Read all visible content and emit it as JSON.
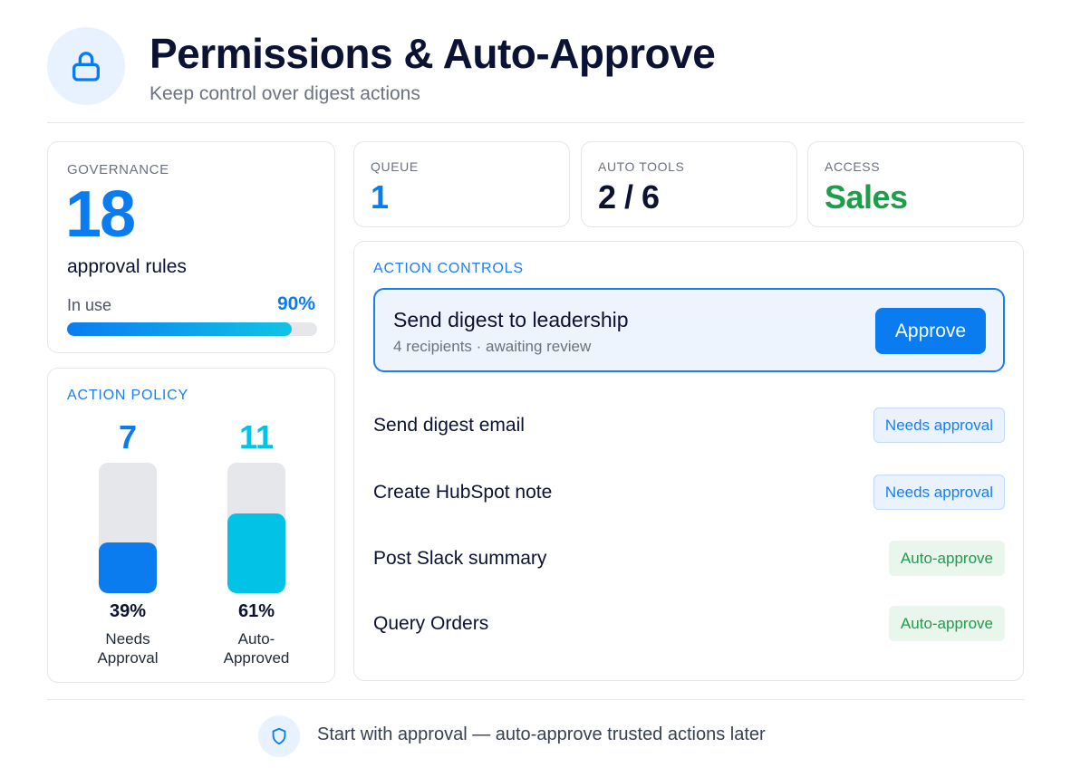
{
  "header": {
    "icon": "lock-icon",
    "title": "Permissions & Auto-Approve",
    "subtitle": "Keep control over digest actions"
  },
  "governance": {
    "label": "GOVERNANCE",
    "value": "18",
    "value_sub": "approval rules",
    "in_use_label": "In use",
    "in_use_value": "90%",
    "in_use_fraction": 0.9
  },
  "policy": {
    "label": "ACTION POLICY",
    "columns": [
      {
        "count": "7",
        "percent": "39%",
        "fraction": 0.39,
        "label_line1": "Needs",
        "label_line2": "Approval",
        "color": "#0b7cf0"
      },
      {
        "count": "11",
        "percent": "61%",
        "fraction": 0.61,
        "label_line1": "Auto-",
        "label_line2": "Approved",
        "color": "#02c2e6"
      }
    ]
  },
  "stats": [
    {
      "label": "QUEUE",
      "value": "1",
      "color": "#0b7cf0"
    },
    {
      "label": "AUTO TOOLS",
      "value": "2 / 6",
      "color": "#0b1233"
    },
    {
      "label": "ACCESS",
      "value": "Sales",
      "color": "#1f9d4a"
    }
  ],
  "controls": {
    "label": "ACTION CONTROLS",
    "featured": {
      "title": "Send digest to leadership",
      "subtitle": "4 recipients · awaiting review",
      "button_label": "Approve"
    },
    "rows": [
      {
        "label": "Send digest email",
        "status": "Needs approval",
        "kind": "need"
      },
      {
        "label": "Create HubSpot note",
        "status": "Needs approval",
        "kind": "need"
      },
      {
        "label": "Post Slack summary",
        "status": "Auto-approve",
        "kind": "auto"
      },
      {
        "label": "Query Orders",
        "status": "Auto-approve",
        "kind": "auto"
      }
    ]
  },
  "footer": {
    "icon": "shield-icon",
    "text": "Start with approval — auto-approve trusted actions later"
  },
  "colors": {
    "accent": "#0b7cf0",
    "cyan": "#02c2e6",
    "success": "#1f9d4a"
  }
}
